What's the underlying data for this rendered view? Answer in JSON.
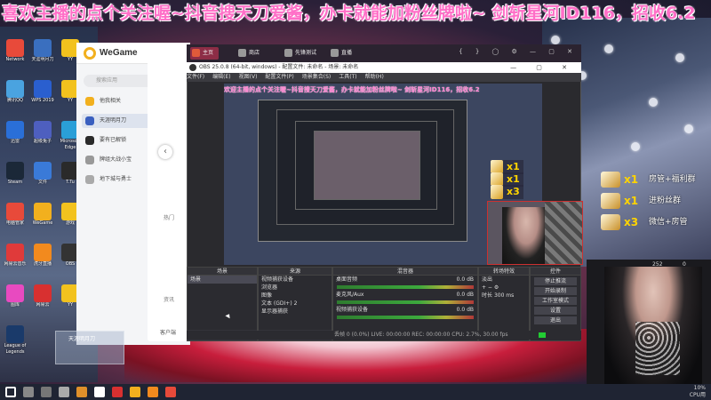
{
  "marquee": {
    "text": "喜欢主播的点个关注喔~抖音搜天刀爱酱，办卡就能加粉丝牌啦~  剑斩星河ID116，招收6.2"
  },
  "desktop_icons": [
    {
      "label": "Network",
      "color": "#e84a3a"
    },
    {
      "label": "天涯明月刀",
      "color": "#3a6fbf"
    },
    {
      "label": "YY",
      "color": "#f2c21e"
    },
    {
      "label": "腾讯QQ",
      "color": "#4aa3e0"
    },
    {
      "label": "WPS 2019",
      "color": "#2a5fcf"
    },
    {
      "label": "YY",
      "color": "#f2c21e"
    },
    {
      "label": "迅雷",
      "color": "#2a6fd8"
    },
    {
      "label": "超级兔子",
      "color": "#4e5fbf"
    },
    {
      "label": "Microsoft Edge",
      "color": "#2a9fd8"
    },
    {
      "label": "Steam",
      "color": "#1b2838"
    },
    {
      "label": "文件",
      "color": "#3a7ad8"
    },
    {
      "label": "T.Tu",
      "color": "#2a2a2a"
    },
    {
      "label": "电脑管家",
      "color": "#e84a3a"
    },
    {
      "label": "WeGame",
      "color": "#f2b01e"
    },
    {
      "label": "游戏",
      "color": "#f2c21e"
    },
    {
      "label": "网易云音乐",
      "color": "#e03a3a"
    },
    {
      "label": "虎牙直播",
      "color": "#f28a1e"
    },
    {
      "label": "OBS",
      "color": "#333"
    },
    {
      "label": "图库",
      "color": "#e84ac0"
    },
    {
      "label": "网易云",
      "color": "#d83030"
    },
    {
      "label": "YY",
      "color": "#f2c21e"
    },
    {
      "label": "League of Legends",
      "color": "#1a3a6a"
    }
  ],
  "wegame": {
    "title": "WeGame",
    "search_placeholder": "搜索应用",
    "nav": [
      "他我相关",
      "天涯明月刀",
      "要有已解锁",
      "牌组大战小宝",
      "地下城与勇士"
    ],
    "active_index": 1,
    "hot_label": "热门",
    "news_label": "资讯",
    "client_label": "客户端"
  },
  "topbar": {
    "tabs": [
      {
        "label": "主页",
        "color": "#e05a3a"
      },
      {
        "label": "商店",
        "color": "#999"
      },
      {
        "label": "先锋测试",
        "color": "#999"
      },
      {
        "label": "直播",
        "color": "#999"
      }
    ],
    "active_tab": 0,
    "right_icons": "{ } ◯ ⚙ — ▢ ✕"
  },
  "obs": {
    "title": "OBS 25.0.8 (64-bit, windows) - 配置文件: 未命名 - 场景: 未命名",
    "menu": [
      "文件(F)",
      "编辑(E)",
      "视图(V)",
      "配置文件(P)",
      "场景集合(S)",
      "工具(T)",
      "帮助(H)"
    ],
    "preview_marquee": "欢迎主播的点个关注喔~抖音搜天刀爱酱，办卡就能加粉丝牌啦~  剑斩星河ID116，招收6.2",
    "docks": {
      "scenes": {
        "title": "场景",
        "items": [
          "场景"
        ]
      },
      "sources": {
        "title": "来源",
        "items": [
          "视频捕获设备",
          "浏览器",
          "图像",
          "文本 (GDI+) 2",
          "显示器捕获"
        ]
      },
      "mixer": {
        "title": "混音器",
        "channels": [
          "桌面音频",
          "麦克风/Aux",
          "视频捕获设备"
        ],
        "levels": [
          "0.0 dB",
          "0.0 dB",
          "0.0 dB"
        ]
      },
      "transitions": {
        "title": "转场特效",
        "type": "淡出",
        "duration_label": "时长",
        "duration": "300 ms"
      },
      "controls": {
        "title": "控件",
        "buttons": [
          "停止推流",
          "开始录制",
          "工作室模式",
          "设置",
          "退出"
        ]
      }
    },
    "status": "丢帧 0 (0.0%)   LIVE: 00:00:00   REC: 00:00:00   CPU: 2.7%, 30.00 fps"
  },
  "gifts": [
    {
      "count": "x1",
      "text": "房管+福利群"
    },
    {
      "count": "x1",
      "text": "进粉丝群"
    },
    {
      "count": "x3",
      "text": "微信+房管"
    }
  ],
  "preview_gifts": [
    {
      "count": "x1"
    },
    {
      "count": "x1"
    },
    {
      "count": "x3"
    }
  ],
  "webcam_stats": [
    "252",
    "0"
  ],
  "taskbar": {
    "icons": [
      "#ffffff",
      "#888",
      "#777",
      "#aaa",
      "#e0902a",
      "#fff",
      "#d83030",
      "#f2b01e",
      "#f28a1e",
      "#e84a3a"
    ],
    "tray_top": "10%",
    "tray_bottom": "CPU用"
  },
  "ghost_window": {
    "label": "天涯明月刀"
  }
}
